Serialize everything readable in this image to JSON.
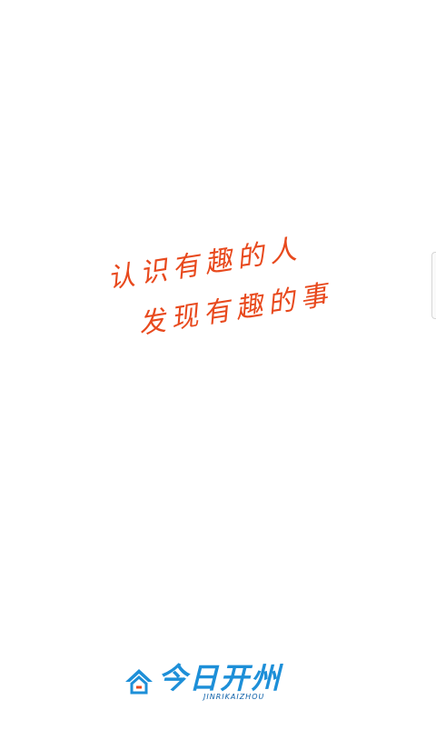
{
  "slogan": {
    "line1": "认识有趣的人",
    "line2": "发现有趣的事"
  },
  "logo": {
    "title": "今日开州",
    "subtitle": "JINRIKAIZHOU",
    "icon": "house-arrow-icon"
  },
  "colors": {
    "background": "#ffffff",
    "slogan": "#e8491d",
    "brand": "#1d8fd8",
    "brand_dark": "#0b5fa8"
  }
}
